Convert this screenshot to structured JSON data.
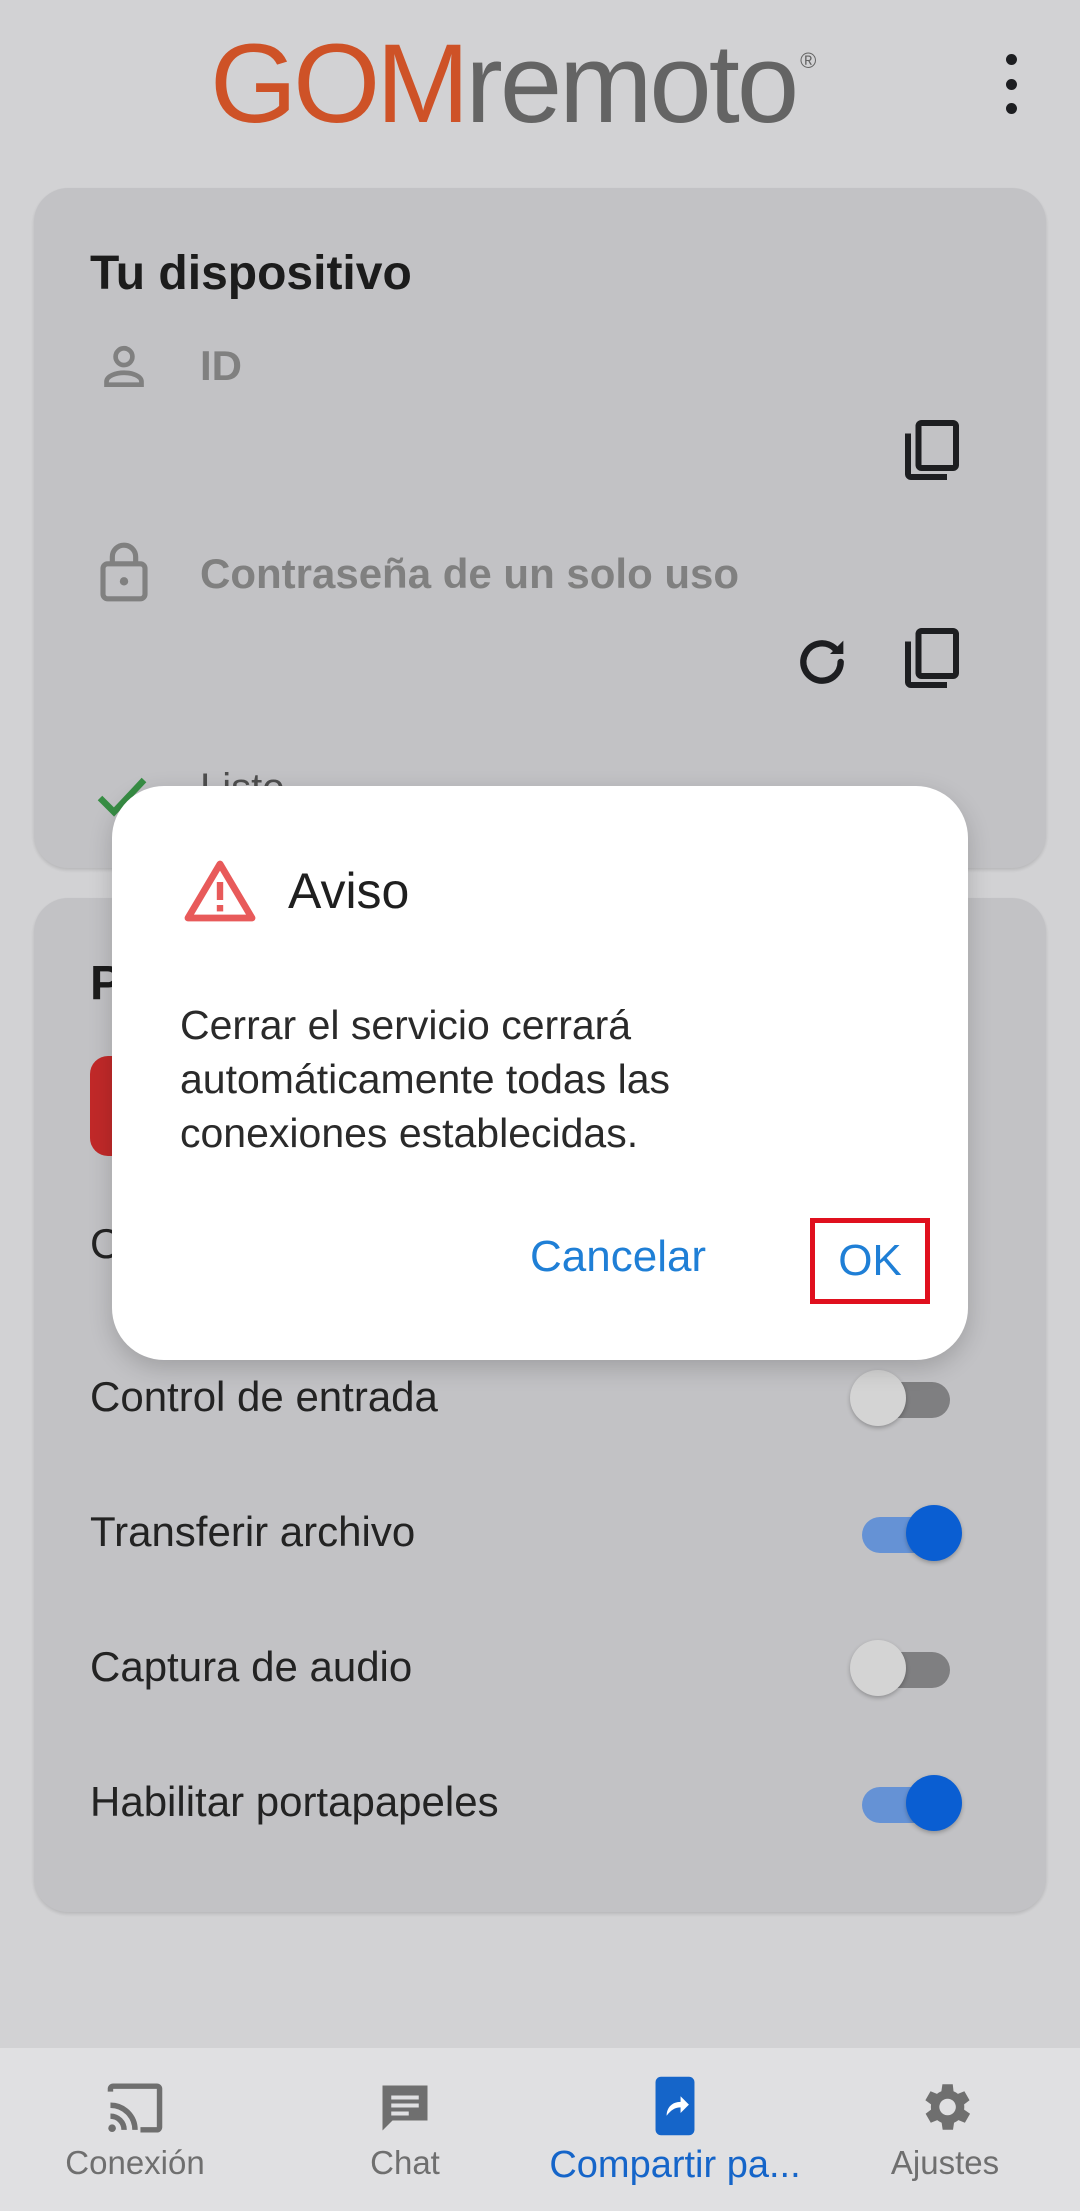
{
  "header": {
    "logo_part1": "GOM",
    "logo_part2": "remoto",
    "logo_reg": "®"
  },
  "device_card": {
    "title": "Tu dispositivo",
    "id_label": "ID",
    "password_label": "Contraseña de un solo uso",
    "status_text": "Listo"
  },
  "permissions_card": {
    "title_initial": "P",
    "hidden_row_initial": "C",
    "toggles": [
      {
        "label": "Control de entrada",
        "on": false
      },
      {
        "label": "Transferir archivo",
        "on": true
      },
      {
        "label": "Captura de audio",
        "on": false
      },
      {
        "label": "Habilitar portapapeles",
        "on": true
      }
    ]
  },
  "dialog": {
    "title": "Aviso",
    "body": "Cerrar el servicio cerrará automáticamente todas las conexiones establecidas.",
    "cancel_label": "Cancelar",
    "ok_label": "OK"
  },
  "bottom_nav": {
    "items": [
      {
        "label": "Conexión",
        "icon": "cast-icon",
        "active": false
      },
      {
        "label": "Chat",
        "icon": "chat-icon",
        "active": false
      },
      {
        "label": "Compartir pa...",
        "icon": "share-screen-icon",
        "active": true
      },
      {
        "label": "Ajustes",
        "icon": "settings-icon",
        "active": false
      }
    ]
  },
  "colors": {
    "brand_orange": "#e05a2b",
    "accent_blue": "#0b66e4",
    "dialog_button": "#1f7fd6",
    "warning_red": "#e85a5a",
    "highlight_red": "#e0101e",
    "check_green": "#3c9a4a"
  }
}
